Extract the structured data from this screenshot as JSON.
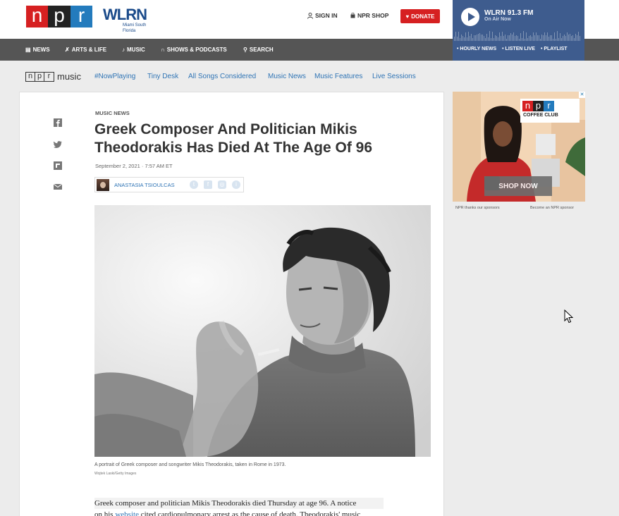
{
  "header": {
    "npr_logo_letters": [
      "n",
      "p",
      "r"
    ],
    "station_logo": "WLRN",
    "station_sub": "Miami South Florida",
    "sign_in": "SIGN IN",
    "npr_shop": "NPR SHOP",
    "donate": "DONATE"
  },
  "player": {
    "station": "WLRN 91.3 FM",
    "status": "On Air Now",
    "links": [
      "HOURLY NEWS",
      "LISTEN LIVE",
      "PLAYLIST"
    ]
  },
  "nav": {
    "items": [
      {
        "label": "NEWS",
        "icon": "news-icon"
      },
      {
        "label": "ARTS & LIFE",
        "icon": "arts-icon"
      },
      {
        "label": "MUSIC",
        "icon": "music-note-icon"
      },
      {
        "label": "SHOWS & PODCASTS",
        "icon": "headphones-icon"
      },
      {
        "label": "SEARCH",
        "icon": "search-icon"
      }
    ]
  },
  "music_nav": {
    "logo_letters": [
      "n",
      "p",
      "r"
    ],
    "logo_word": "music",
    "links": [
      "#NowPlaying",
      "Tiny Desk",
      "All Songs Considered",
      "Music News",
      "Music Features",
      "Live Sessions"
    ]
  },
  "article": {
    "kicker": "MUSIC NEWS",
    "headline": "Greek Composer And Politician Mikis Theodorakis Has Died At The Age Of 96",
    "date": "September 2, 2021 · 7:57 AM ET",
    "author": "ANASTASIA TSIOULCAS",
    "caption": "A portrait of Greek composer and songwriter Mikis Theodorakis, taken in Rome in 1973.",
    "credit": "Wojtek Laski/Getty Images",
    "body_line1": "Greek composer and politician Mikis Theodorakis died Thursday at age 96. A notice",
    "body_line2_pre": "on his ",
    "body_link": "website",
    "body_line2_post": " cited cardiopulmonary arrest as the cause of death. Theodorakis' music"
  },
  "ad": {
    "brand_letters": [
      "n",
      "p",
      "r"
    ],
    "brand_sub": "COFFEE CLUB",
    "cta": "SHOP NOW",
    "thanks": "NPR thanks our sponsors",
    "become": "Become an NPR sponsor"
  },
  "colors": {
    "npr_red": "#d62021",
    "npr_blue": "#237bbd",
    "player_blue": "#3e5c8e",
    "link_blue": "#2f74b5",
    "nav_gray": "#555555"
  }
}
